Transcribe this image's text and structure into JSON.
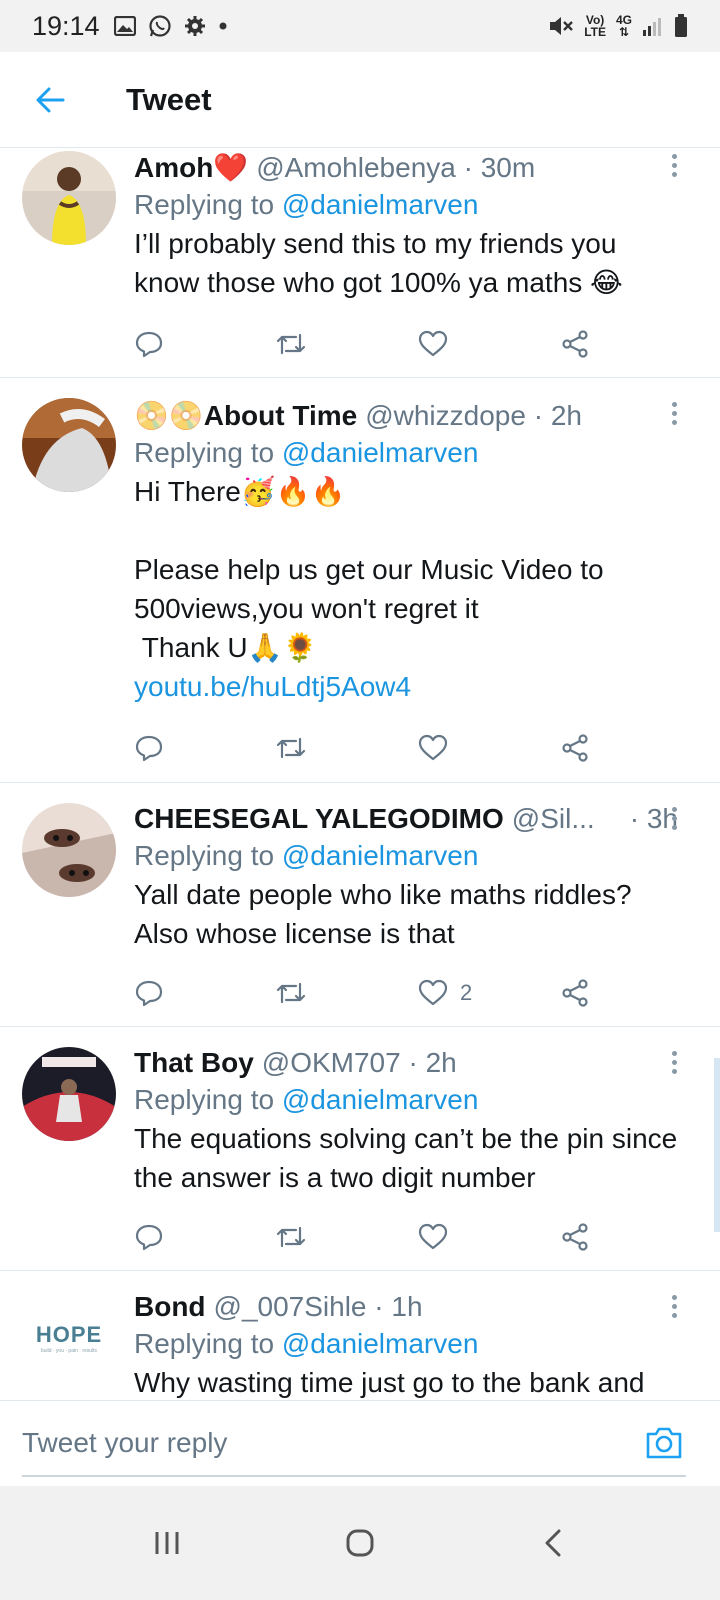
{
  "status_bar": {
    "time": "19:14",
    "volte_top": "Vo)",
    "volte_bottom": "LTE",
    "network_top": "4G",
    "network_bottom": "⇅",
    "icons": [
      "gallery-icon",
      "whatsapp-icon",
      "settings-icon",
      "notification-dot-icon",
      "mute-icon",
      "signal-icon",
      "battery-icon"
    ]
  },
  "header": {
    "title": "Tweet",
    "back_icon": "back-arrow-icon",
    "accent_color": "#1da1f2"
  },
  "tweets": [
    {
      "name": "Amoh❤️",
      "handle": "@Amohlebenya · 30m",
      "replying_prefix": "Replying to",
      "replying_to": "@danielmarven",
      "text": "I’ll probably send this to my friends you know those who got 100% ya maths 😂",
      "like_count": ""
    },
    {
      "name": "📀📀About Time",
      "handle": "@whizzdope · 2h",
      "replying_prefix": "Replying to",
      "replying_to": "@danielmarven",
      "text": "Hi There🥳🔥🔥\n\nPlease help us get our Music Video to 500views,you won't regret it\n Thank U🙏🌻",
      "link": "youtu.be/huLdtj5Aow4",
      "like_count": ""
    },
    {
      "name": "CHEESEGAL YALEGODIMO",
      "handle": "@Sil...",
      "time": "· 3h",
      "replying_prefix": "Replying to",
      "replying_to": "@danielmarven",
      "text": "Yall date people who like maths riddles? Also whose license is that",
      "like_count": "2"
    },
    {
      "name": "That Boy",
      "handle": "@OKM707 · 2h",
      "replying_prefix": "Replying to",
      "replying_to": "@danielmarven",
      "text": "The equations solving can’t be the pin since the answer is a two digit number",
      "like_count": ""
    },
    {
      "name": "Bond",
      "handle": "@_007Sihle · 1h",
      "replying_prefix": "Replying to",
      "replying_to": "@danielmarven",
      "text": "Why wasting time just go to the bank and",
      "avatar_text": "HOPE",
      "avatar_subtext": "build  ·  you  ·  pain  ·  results"
    }
  ],
  "reply_composer": {
    "placeholder": "Tweet your reply",
    "camera_icon": "camera-icon"
  },
  "nav_bar": {
    "icons": [
      "recent-apps-icon",
      "home-icon",
      "back-icon"
    ]
  }
}
